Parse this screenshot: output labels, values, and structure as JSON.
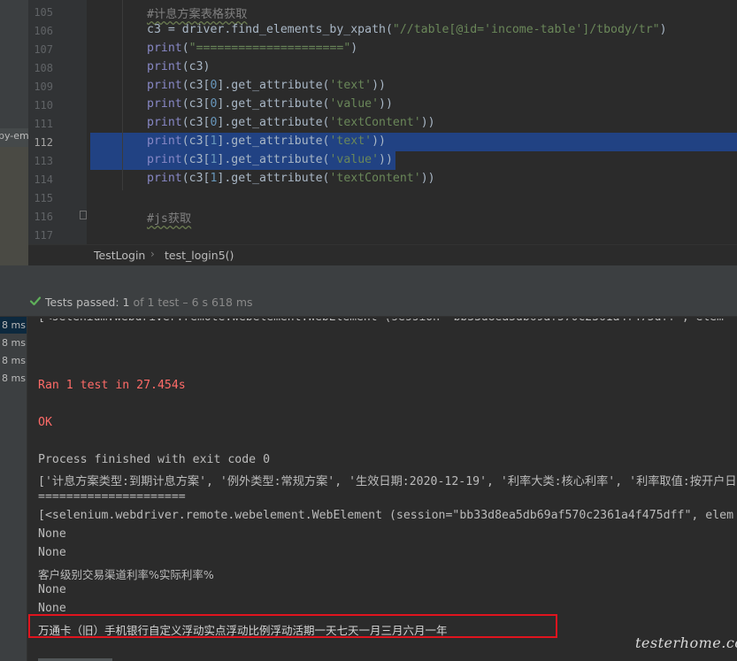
{
  "editor": {
    "lines": [
      {
        "num": "105",
        "text": "#计息方案表格获取"
      },
      {
        "num": "106",
        "text": "c3 = driver.find_elements_by_xpath(\"//table[@id='income-table']/tbody/tr\")"
      },
      {
        "num": "107",
        "text": "print(\"=====================\")"
      },
      {
        "num": "108",
        "text": "print(c3)"
      },
      {
        "num": "109",
        "text": "print(c3[0].get_attribute('text'))"
      },
      {
        "num": "110",
        "text": "print(c3[0].get_attribute('value'))"
      },
      {
        "num": "111",
        "text": "print(c3[0].get_attribute('textContent'))"
      },
      {
        "num": "112",
        "text": "print(c3[1].get_attribute('text'))"
      },
      {
        "num": "113",
        "text": "print(c3[1].get_attribute('value'))"
      },
      {
        "num": "114",
        "text": "print(c3[1].get_attribute('textContent'))"
      },
      {
        "num": "115",
        "text": ""
      },
      {
        "num": "116",
        "text": "#js获取"
      },
      {
        "num": "117",
        "text": ""
      }
    ],
    "side_tab_label": "py-em"
  },
  "breadcrumb": {
    "class_name": "TestLogin",
    "method_name": "test_login5()",
    "separator": "›"
  },
  "test_bar": {
    "passed_label": "Tests passed:",
    "passed_count": "1",
    "rest": "of 1 test – 6 s 618 ms"
  },
  "tree": {
    "durations": [
      "8 ms",
      "8 ms",
      "8 ms",
      "8 ms"
    ]
  },
  "console": {
    "ran_line": "Ran 1 test in 27.454s",
    "ok_line": "OK",
    "process_line": "Process finished with exit code 0",
    "list_line": "['计息方案类型:到期计息方案', '例外类型:常规方案', '生效日期:2020-12-19', '利率大类:核心利率', '利率取值:按开户日'",
    "sep_line": "=====================",
    "elements_line": "[<selenium.webdriver.remote.webelement.WebElement (session=\"bb33d8ea5db69af570c2361a4f475dff\", elem",
    "none_1": "None",
    "none_2": "None",
    "header_row": "客户级别交易渠道利率%实际利率%",
    "none_3": "None",
    "none_4": "None",
    "highlight_row": "万通卡（旧）手机银行自定义浮动实点浮动比例浮动活期一天七天一月三月六月一年"
  },
  "watermark": "testerhome.com",
  "colors": {
    "editor_bg": "#2b2b2b",
    "selection": "#214283",
    "string": "#6a8759",
    "number": "#6897bb",
    "builtin": "#8888c6",
    "error_text": "#ff6b68",
    "highlight_box": "#e0141e",
    "pass_icon": "#5fb05a"
  }
}
